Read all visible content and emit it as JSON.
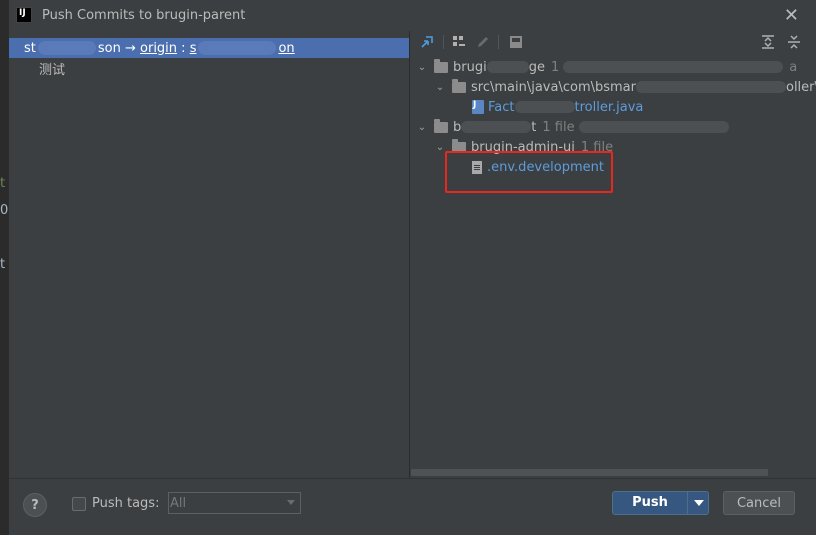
{
  "window": {
    "title": "Push Commits to brugin-parent",
    "app_icon_label": "IJ"
  },
  "background_fragments": {
    "frag1": "t",
    "frag2": "0",
    "frag3": "t"
  },
  "left": {
    "branch_prefix": "st",
    "branch_suffix": "son",
    "arrow": " → ",
    "remote": "origin",
    "sep": " : ",
    "target_prefix": "s",
    "target_suffix": "on",
    "commit_message": "测试"
  },
  "tree": {
    "repo1_name": "brugi",
    "repo1_tail": "ge",
    "repo1_count": "1",
    "repo1_trail": "a",
    "path": "src\\main\\java\\com\\bsmar",
    "path_tail": "oller\\fac",
    "java_file_prefix": "Fact",
    "java_file_suffix": "troller.java",
    "repo2_name": "b",
    "repo2_tail": "t",
    "repo2_count": "1 file",
    "module_name": "brugin-admin-ui",
    "module_count": "1 file",
    "env_file": ".env.development"
  },
  "bottom": {
    "help": "?",
    "push_tags_label": "Push tags:",
    "tags_select_value": "All",
    "push_button": "Push",
    "cancel_button": "Cancel"
  }
}
